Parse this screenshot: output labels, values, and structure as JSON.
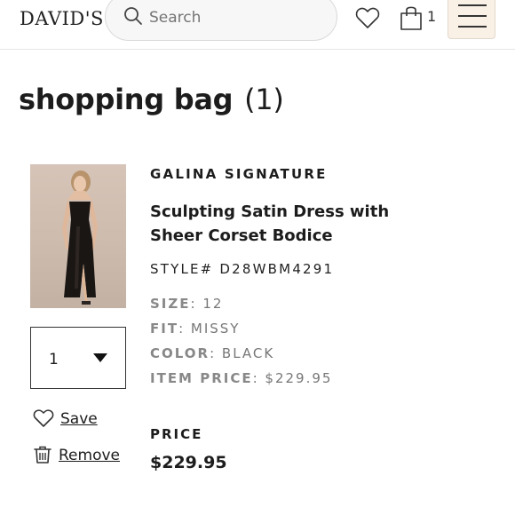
{
  "header": {
    "logo": "DAVID'S",
    "search_placeholder": "Search",
    "bag_count": "1",
    "icons": [
      "search-icon",
      "heart-icon",
      "shopping-bag-icon",
      "hamburger-menu-icon"
    ]
  },
  "page": {
    "title": "shopping bag",
    "item_count": "(1)"
  },
  "item": {
    "brand": "GALINA SIGNATURE",
    "name": "Sculpting Satin Dress with Sheer Corset Bodice",
    "style": "STYLE# D28WBM4291",
    "attributes": [
      {
        "label": "SIZE",
        "value": ": 12"
      },
      {
        "label": "FIT",
        "value": ": MISSY"
      },
      {
        "label": "COLOR",
        "value": ": BLACK"
      },
      {
        "label": "ITEM PRICE",
        "value": ": $229.95"
      }
    ],
    "quantity": "1",
    "save_label": "Save",
    "remove_label": "Remove",
    "price_label": "PRICE",
    "price_value": "$229.95"
  },
  "colors": {
    "menu_background": "#faf1e6",
    "text": "#1c1c1c",
    "muted": "#777777",
    "dress": "#1a1614"
  }
}
